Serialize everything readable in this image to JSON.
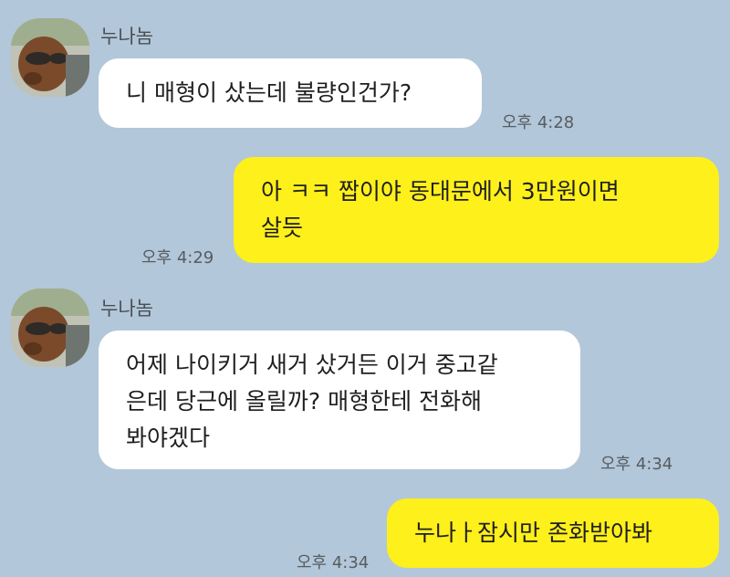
{
  "chat": {
    "messages": [
      {
        "sender": "누나놈",
        "text": "니 매형이 샀는데 불량인건가?",
        "time": "오후 4:28"
      },
      {
        "text": "아 ㅋㅋ 짭이야 동대문에서 3만원이면\n살듯",
        "time": "오후 4:29"
      },
      {
        "sender": "누나놈",
        "text": "어제 나이키거 새거 샀거든 이거 중고같\n은데 당근에 올릴까? 매형한테 전화해\n봐야겠다",
        "time": "오후 4:34"
      },
      {
        "text": "누나ㅏ잠시만 존화받아봐",
        "time": "오후 4:34"
      }
    ]
  },
  "colors": {
    "background": "#b2c7d9",
    "incoming_bubble": "#ffffff",
    "outgoing_bubble": "#fef01b"
  },
  "icons": {
    "avatar": "profile-photo-dog-icon"
  }
}
